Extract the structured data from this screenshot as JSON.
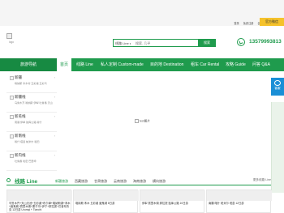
{
  "topbar": {
    "welcome": "",
    "links": [
      "登录",
      "免费注册",
      "会员中心",
      "网站导航"
    ]
  },
  "weixin": {
    "label": "官方微信"
  },
  "header": {
    "logo_text": "logo",
    "search": {
      "select_value": "线路 Line",
      "placeholder": "搜索, 几乎",
      "button": "搜索"
    },
    "phone": "13579993813"
  },
  "nav": {
    "items": [
      "旅游导航",
      "首页",
      "线路 Line",
      "私人定制 Custom-made",
      "目的地 Destination",
      "租车 Car Rental",
      "攻略 Guide",
      "问答 Q&A"
    ]
  },
  "categories": [
    {
      "title": "新疆",
      "sub": "喀纳斯 禾木村 五彩滩 五彩湾"
    },
    {
      "title": "新疆线",
      "sub": "乌鲁木齐 喀纳斯 伊犁 吐鲁番 天山"
    },
    {
      "title": "新羌线",
      "sub": "南疆 伊犁 独库公路 喀什"
    },
    {
      "title": "新南线",
      "sub": "喀什 塔县 帕米尔 和田"
    },
    {
      "title": "新内线",
      "sub": "吐鲁番 哈密 巴里坤"
    }
  ],
  "banner": {
    "alt": "test图片"
  },
  "kefu": {
    "label": "客服"
  },
  "section": {
    "title": "线路 Line",
    "tabs": [
      "新疆旅游",
      "西藏旅游",
      "甘肃旅游",
      "云南旅游",
      "海南旅游",
      "横向旅游"
    ],
    "active_tab": 0,
    "more": "更多线路 Line"
  },
  "cards": [
    {
      "title": "乌鲁木齐+天山天池+五彩滩+布尔津+喀纳斯湖+禾木+魔鬼城+赛里木湖+果子沟+伊宁+那拉提+巴音布鲁克 12日游 Urumqi + Tianchi"
    },
    {
      "title": "喀纳斯 禾木 五彩滩 魔鬼城 8日游"
    },
    {
      "title": "伊犁 赛里木湖 那拉提 独库公路 10日游"
    },
    {
      "title": "南疆 喀什 帕米尔 塔县 12日游"
    }
  ]
}
